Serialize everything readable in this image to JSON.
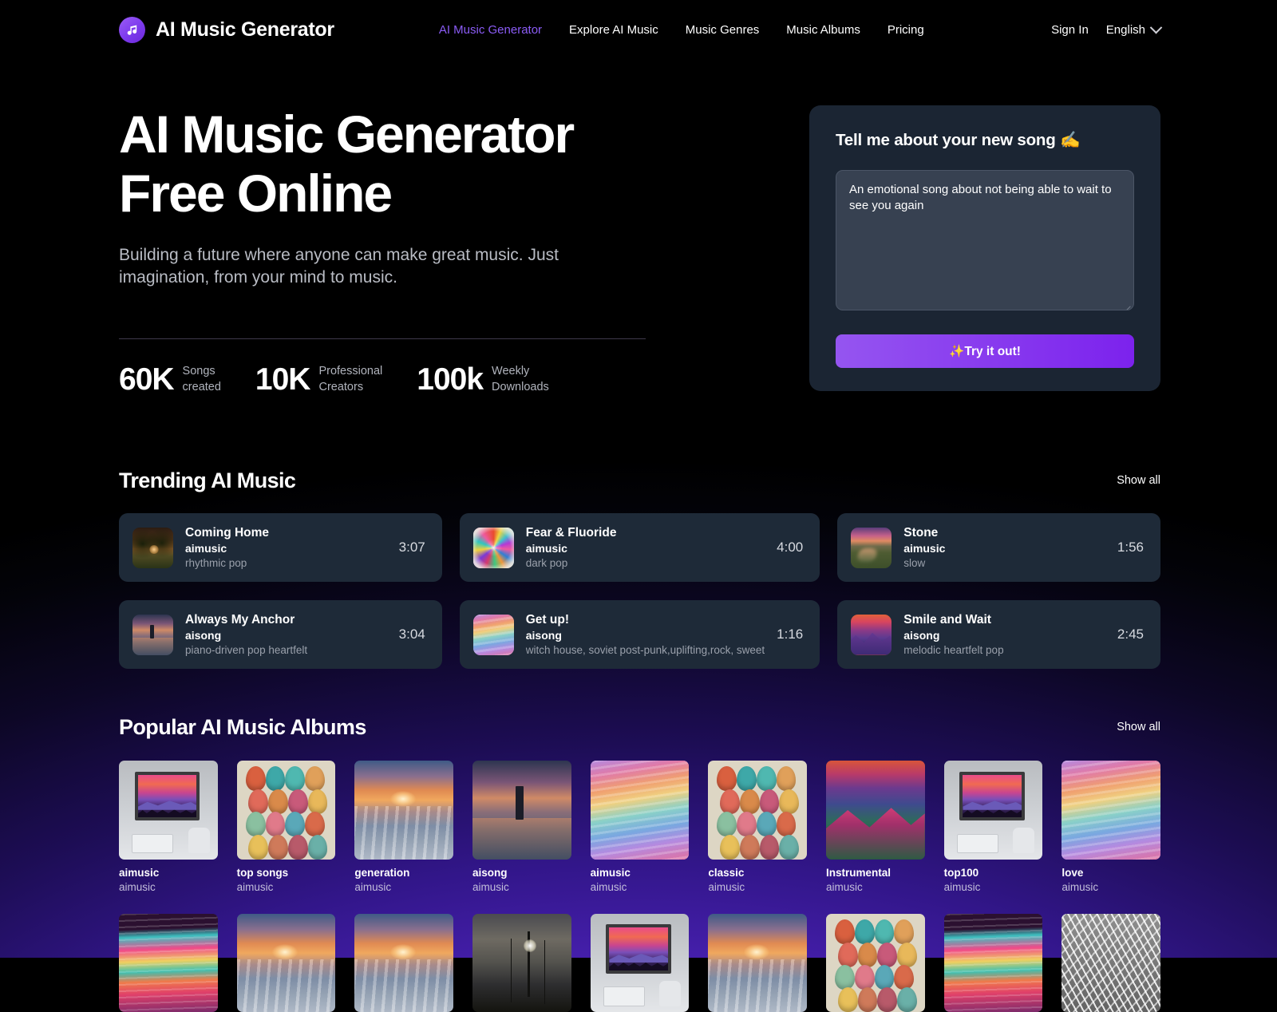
{
  "header": {
    "brand": "AI Music Generator",
    "logo_icon": "music-note-icon",
    "nav": [
      {
        "label": "AI Music Generator",
        "active": true
      },
      {
        "label": "Explore AI Music",
        "active": false
      },
      {
        "label": "Music Genres",
        "active": false
      },
      {
        "label": "Music Albums",
        "active": false
      },
      {
        "label": "Pricing",
        "active": false
      }
    ],
    "sign_in": "Sign In",
    "language": "English",
    "language_chevron": "chevron-down-icon"
  },
  "hero": {
    "title_line1": "AI Music Generator",
    "title_line2": "Free Online",
    "subtitle": "Building a future where anyone can make great music. Just imagination, from your mind to music.",
    "stats": [
      {
        "value": "60K",
        "label_line1": "Songs",
        "label_line2": "created"
      },
      {
        "value": "10K",
        "label_line1": "Professional",
        "label_line2": "Creators"
      },
      {
        "value": "100k",
        "label_line1": "Weekly",
        "label_line2": "Downloads"
      }
    ]
  },
  "prompt_card": {
    "title": "Tell me about your new song ✍️",
    "textarea_value": "An emotional song about not being able to wait to see you again",
    "textarea_placeholder": "Tell me about your new song",
    "button_label": "✨Try it out!",
    "button_color": "#7c22ed",
    "card_bg": "#1b2533"
  },
  "trending": {
    "title": "Trending AI Music",
    "show_all": "Show all",
    "tracks": [
      {
        "name": "Coming Home",
        "author": "aimusic",
        "genre": "rhythmic pop",
        "duration": "3:07",
        "art": "art-field"
      },
      {
        "name": "Fear & Fluoride",
        "author": "aimusic",
        "genre": "dark pop",
        "duration": "4:00",
        "art": "art-burst"
      },
      {
        "name": "Stone",
        "author": "aimusic",
        "genre": "slow",
        "duration": "1:56",
        "art": "art-river"
      },
      {
        "name": "Always My Anchor",
        "author": "aisong",
        "genre": "piano-driven pop heartfelt",
        "duration": "3:04",
        "art": "art-light"
      },
      {
        "name": "Get up!",
        "author": "aisong",
        "genre": "witch house, soviet post-punk,uplifting,rock, sweet",
        "duration": "1:16",
        "art": "art-wave"
      },
      {
        "name": "Smile and Wait",
        "author": "aisong",
        "genre": "melodic heartfelt pop",
        "duration": "2:45",
        "art": "art-mtn"
      }
    ]
  },
  "albums": {
    "title": "Popular AI Music Albums",
    "show_all": "Show all",
    "items": [
      {
        "name": "aimusic",
        "author": "aimusic",
        "art": "art-room"
      },
      {
        "name": "top songs",
        "author": "aimusic",
        "art": "art-masks"
      },
      {
        "name": "generation",
        "author": "aimusic",
        "art": "art-beach"
      },
      {
        "name": "aisong",
        "author": "aimusic",
        "art": "art-light"
      },
      {
        "name": "aimusic",
        "author": "aimusic",
        "art": "art-wave"
      },
      {
        "name": "classic",
        "author": "aimusic",
        "art": "art-masks"
      },
      {
        "name": "Instrumental",
        "author": "aimusic",
        "art": "art-valley"
      },
      {
        "name": "top100",
        "author": "aimusic",
        "art": "art-room"
      },
      {
        "name": "love",
        "author": "aimusic",
        "art": "art-wave"
      }
    ],
    "row2": [
      {
        "art": "art-pinkwave"
      },
      {
        "art": "art-beach"
      },
      {
        "art": "art-beach"
      },
      {
        "art": "art-ship"
      },
      {
        "art": "art-room"
      },
      {
        "art": "art-beach"
      },
      {
        "art": "art-masks"
      },
      {
        "art": "art-pinkwave"
      },
      {
        "art": "art-branch"
      }
    ]
  }
}
